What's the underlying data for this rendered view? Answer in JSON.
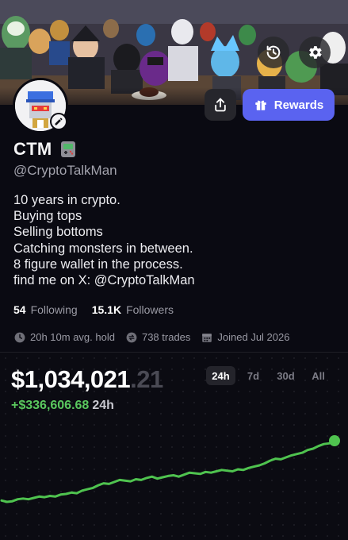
{
  "profile": {
    "display_name": "CTM",
    "handle": "@CryptoTalkMan",
    "bio": [
      "10 years in crypto.",
      "Buying tops",
      "Selling bottoms",
      "Catching monsters in between.",
      "8 figure wallet in the process.",
      "find me on X: @CryptoTalkMan"
    ],
    "following_count": "54",
    "following_label": "Following",
    "followers_count": "15.1K",
    "followers_label": "Followers",
    "avg_hold": "20h 10m avg. hold",
    "trades": "738 trades",
    "joined": "Joined Jul 2026"
  },
  "actions": {
    "rewards_label": "Rewards"
  },
  "portfolio": {
    "value_main": "$1,034,021",
    "value_cents": ".21",
    "change_amount": "+$336,606.68",
    "change_period": "24h",
    "ranges": [
      "24h",
      "7d",
      "30d",
      "All"
    ],
    "active_range": "24h"
  },
  "icons": {
    "history": "history-icon",
    "settings": "gear-icon",
    "share": "share-icon",
    "rewards": "gift-icon",
    "clock": "clock-icon",
    "trades": "swap-icon",
    "calendar": "calendar-icon",
    "edit": "pencil-icon",
    "name_badge": "game-badge-icon"
  },
  "colors": {
    "accent": "#5a63f0",
    "positive": "#5ac85e",
    "line": "#4fc34f",
    "background": "#0a0a12"
  },
  "chart_data": {
    "type": "line",
    "series": [
      {
        "values": [
          10,
          8,
          9,
          12,
          13,
          12,
          14,
          16,
          15,
          17,
          16,
          19,
          20,
          22,
          21,
          25,
          27,
          29,
          33,
          36,
          35,
          38,
          41,
          40,
          39,
          42,
          41,
          44,
          46,
          43,
          45,
          47,
          48,
          46,
          49,
          52,
          51,
          50,
          53,
          52,
          54,
          56,
          55,
          54,
          57,
          56,
          59,
          61,
          63,
          66,
          70,
          73,
          72,
          75,
          78,
          80,
          82,
          86,
          88,
          92,
          95,
          96,
          100
        ]
      }
    ],
    "title": "",
    "xlabel": "",
    "ylabel": "",
    "grid": false
  }
}
